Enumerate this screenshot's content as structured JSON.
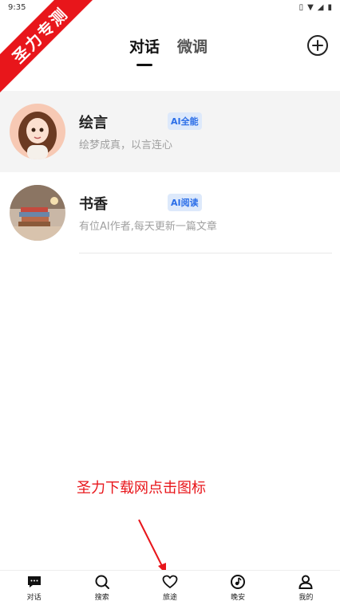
{
  "status_bar": {
    "time": "9:35"
  },
  "ribbon": {
    "text": "圣力专测"
  },
  "header": {
    "tabs": [
      {
        "label": "对话",
        "active": true
      },
      {
        "label": "微调",
        "active": false
      }
    ]
  },
  "chats": [
    {
      "name": "绘言",
      "badge": "AI全能",
      "description": "绘梦成真，以言连心"
    },
    {
      "name": "书香",
      "badge": "AI阅读",
      "description": "有位AI作者,每天更新一篇文章"
    }
  ],
  "promo": {
    "text": "圣力下载网点击图标"
  },
  "bottom_nav": [
    {
      "label": "对话",
      "icon": "chat-icon"
    },
    {
      "label": "搜索",
      "icon": "search-icon"
    },
    {
      "label": "旅途",
      "icon": "heart-icon"
    },
    {
      "label": "晚安",
      "icon": "moon-music-icon"
    },
    {
      "label": "我的",
      "icon": "person-icon"
    }
  ],
  "colors": {
    "accent_red": "#e8161b",
    "badge_bg": "#dde9fb",
    "badge_text": "#2b6ee8"
  }
}
